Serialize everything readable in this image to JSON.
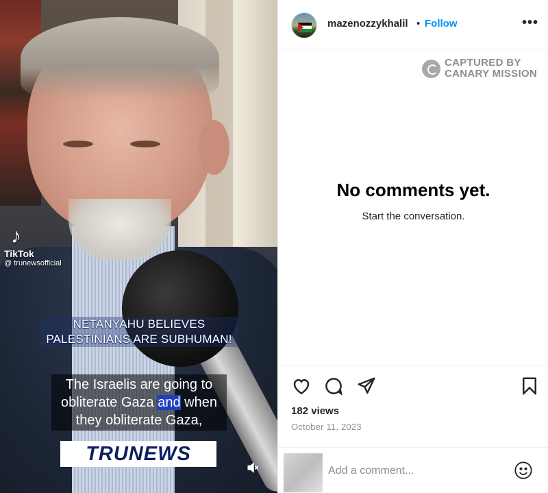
{
  "video": {
    "tiktok_brand": "TikTok",
    "tiktok_handle": "@ trunewsofficial",
    "caption_top_line1": "NETANYAHU BELIEVES",
    "caption_top_line2": "PALESTINIANS ARE SUBHUMAN!",
    "subtitle_line1": "The Israelis are going to",
    "subtitle_line2_a": "obliterate Gaza ",
    "subtitle_line2_hl": "and",
    "subtitle_line2_b": " when",
    "subtitle_line3": "they obliterate Gaza,",
    "logo_a": "TRU",
    "logo_b": "NEWS",
    "mute_icon": "speaker-muted-icon"
  },
  "post": {
    "username": "mazenozzykhalil",
    "separator": "•",
    "follow_label": "Follow",
    "more_label": "•••",
    "watermark_line1": "CAPTURED BY",
    "watermark_line2": "CANARY MISSION",
    "empty_title": "No comments yet.",
    "empty_subtitle": "Start the conversation.",
    "views": "182 views",
    "date": "October 11, 2023",
    "comment_placeholder": "Add a comment..."
  },
  "colors": {
    "follow_blue": "#0095f6",
    "muted_text": "#8e8e8e",
    "subtitle_highlight": "#1f3fbf"
  }
}
